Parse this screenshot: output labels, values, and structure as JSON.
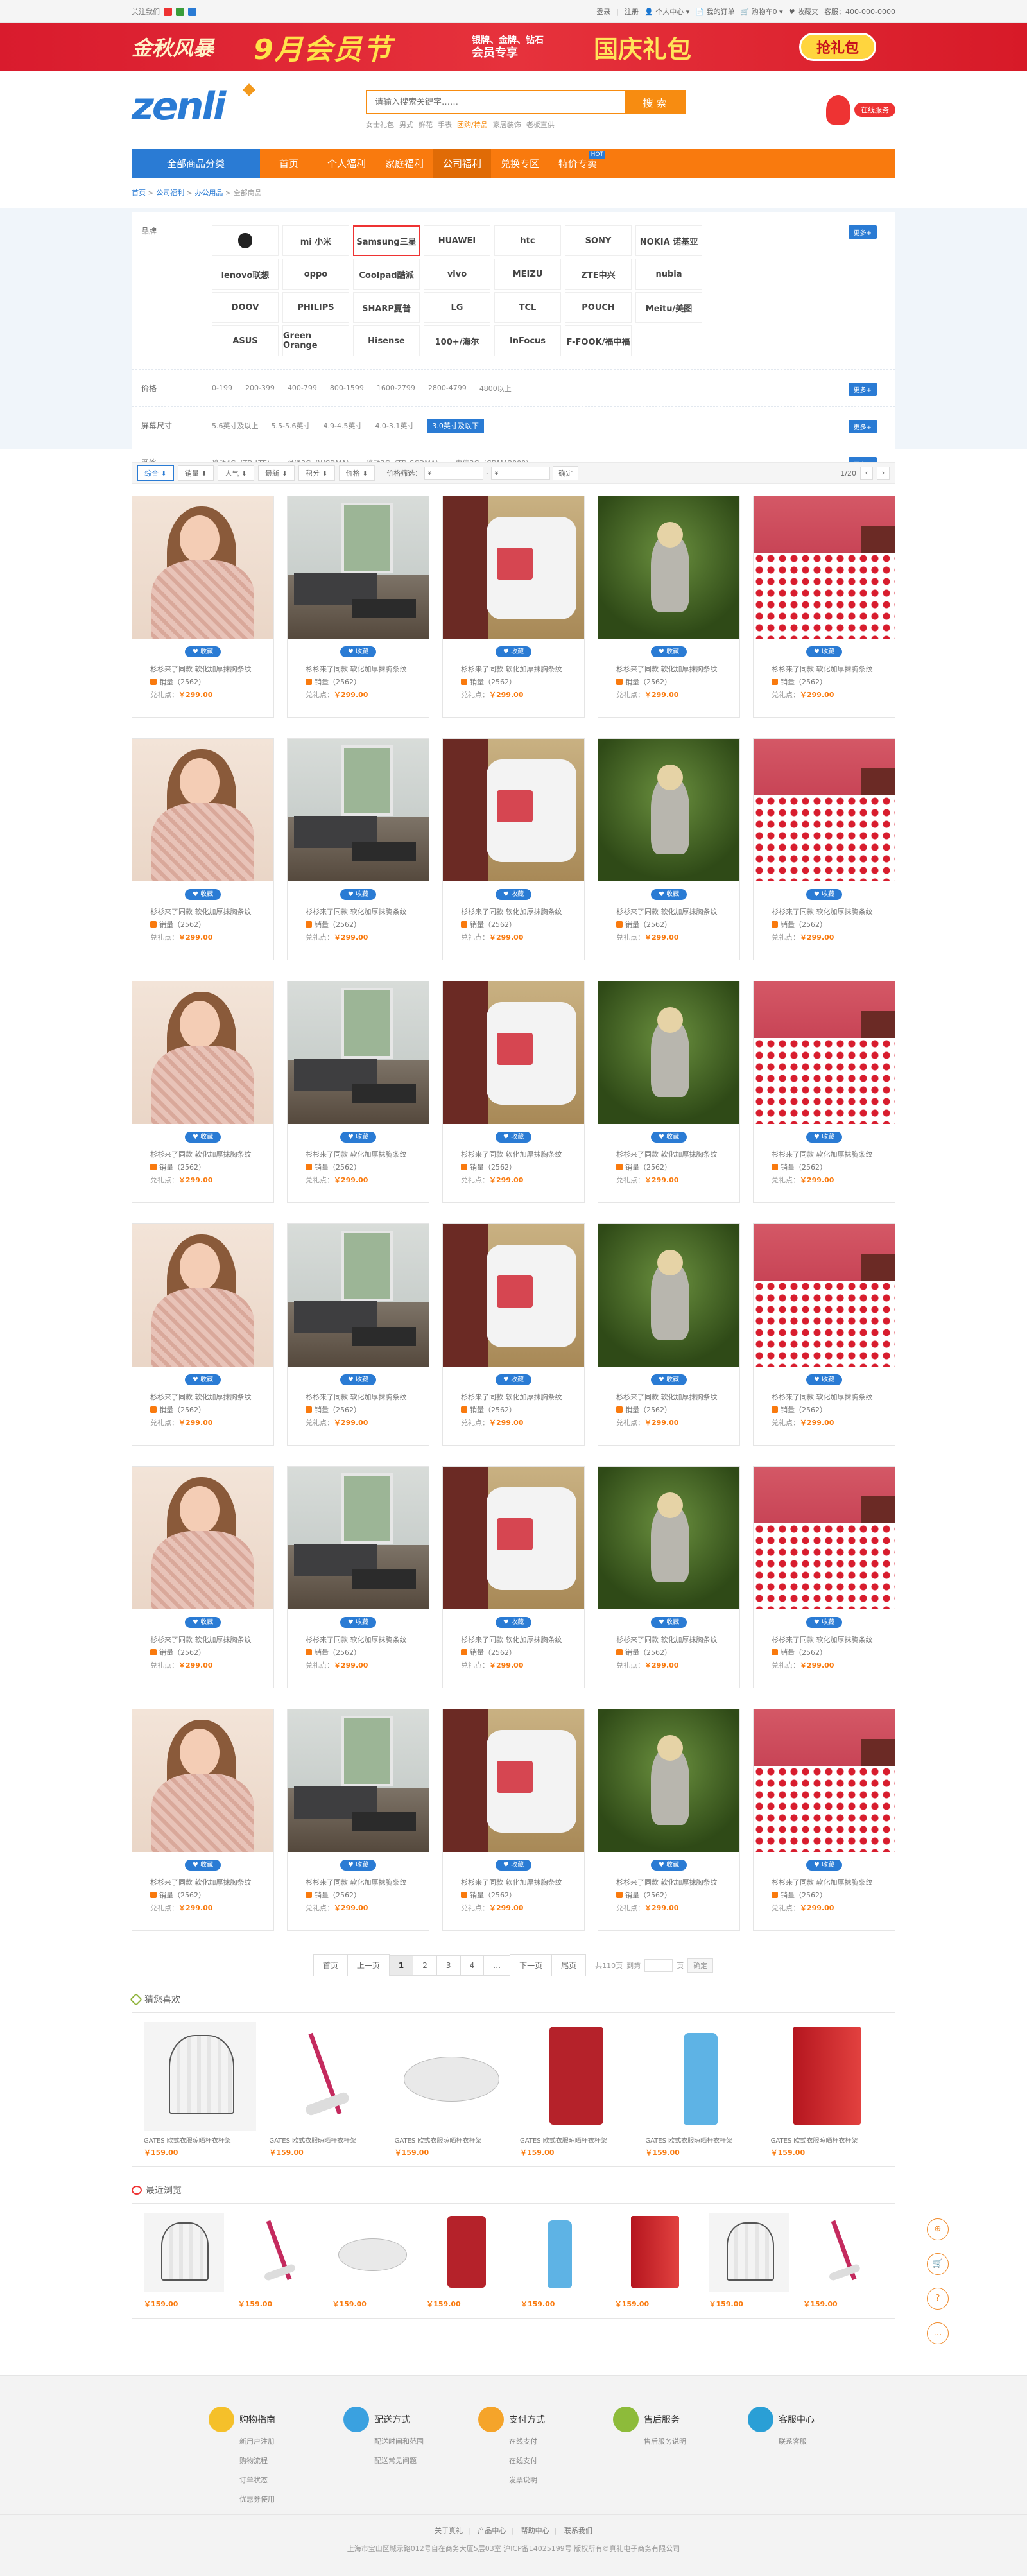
{
  "topbar": {
    "follow": "关注我们",
    "login": "登录",
    "register": "注册",
    "user_center": "个人中心",
    "orders": "我的订单",
    "cart": "购物车",
    "cart_count": "0",
    "favorites": "收藏夹",
    "hotline": "客服：400-000-0000"
  },
  "banner": {
    "a": "金秋风暴",
    "b": "9月会员节",
    "c1": "银牌、金牌、钻石",
    "c2": "会员专享",
    "d": "国庆礼包",
    "btn": "抢礼包"
  },
  "header": {
    "logo": "zenli",
    "search_placeholder": "请输入搜索关键字……",
    "search_btn": "搜 索",
    "hot_words": [
      "女士礼包",
      "男式",
      "鲜花",
      "手表",
      "团购/特品",
      "家居装饰",
      "老板直供"
    ],
    "service": "在线服务"
  },
  "nav": {
    "all": "全部商品分类",
    "items": [
      "首页",
      "个人福利",
      "家庭福利",
      "公司福利",
      "兑换专区",
      "特价专卖"
    ],
    "hot_badge": "HOT"
  },
  "breadcrumb": [
    "首页",
    "公司福利",
    "办公用品",
    "全部商品"
  ],
  "filter": {
    "brand_label": "品牌",
    "brands": [
      "",
      "mi 小米",
      "Samsung三星",
      "HUAWEI",
      "htc",
      "SONY",
      "NOKIA 诺基亚",
      "lenovo联想",
      "oppo",
      "Coolpad酷派",
      "vivo",
      "MEIZU",
      "ZTE中兴",
      "nubia",
      "DOOV",
      "PHILIPS",
      "SHARP夏普",
      "LG",
      "TCL",
      "POUCH",
      "Meitu/美图",
      "ASUS",
      "Green Orange",
      "Hisense",
      "100+/海尔",
      "InFocus",
      "F-FOOK/福中福"
    ],
    "price_label": "价格",
    "prices": [
      "0-199",
      "200-399",
      "400-799",
      "800-1599",
      "1600-2799",
      "2800-4799",
      "4800以上"
    ],
    "screen_label": "屏幕尺寸",
    "screens": [
      "5.6英寸及以上",
      "5.5-5.6英寸",
      "4.9-4.5英寸",
      "4.0-3.1英寸",
      "3.0英寸及以下"
    ],
    "net_label": "网络",
    "nets": [
      "移动4G（TD-LTE）",
      "联通3G（WCDMA）",
      "移动3G（TD-SCDMA）",
      "电信3G（CDMA2000）"
    ],
    "more": "更多"
  },
  "sortbar": {
    "sorts": [
      "综合",
      "销量",
      "人气",
      "最新",
      "积分",
      "价格"
    ],
    "price_filter_label": "价格筛选：",
    "price_from": "¥",
    "price_to": "¥",
    "confirm": "确定",
    "page": "1/20"
  },
  "product_common": {
    "fav": "♥ 收藏",
    "title": "杉杉来了同款 软化加厚抹胸条纹",
    "sales": "销量（2562）",
    "price_label": "兑礼点：",
    "price": "￥299.00"
  },
  "products": [
    {
      "img": "scarf"
    },
    {
      "img": "room"
    },
    {
      "img": "cooker"
    },
    {
      "img": "boy"
    },
    {
      "img": "bed"
    },
    {
      "img": "scarf"
    },
    {
      "img": "room"
    },
    {
      "img": "cooker"
    },
    {
      "img": "boy"
    },
    {
      "img": "bed"
    },
    {
      "img": "scarf"
    },
    {
      "img": "room"
    },
    {
      "img": "cooker"
    },
    {
      "img": "boy"
    },
    {
      "img": "bed"
    },
    {
      "img": "scarf"
    },
    {
      "img": "room"
    },
    {
      "img": "cooker"
    },
    {
      "img": "boy"
    },
    {
      "img": "bed"
    },
    {
      "img": "scarf"
    },
    {
      "img": "room"
    },
    {
      "img": "cooker"
    },
    {
      "img": "boy"
    },
    {
      "img": "bed"
    },
    {
      "img": "scarf"
    },
    {
      "img": "room"
    },
    {
      "img": "cooker"
    },
    {
      "img": "boy"
    },
    {
      "img": "bed"
    }
  ],
  "pager": {
    "first": "首页",
    "prev": "上一页",
    "pages": [
      "1",
      "2",
      "3",
      "4",
      "…"
    ],
    "next": "下一页",
    "last": "尾页",
    "total": "共110页",
    "goto": "到第",
    "unit": "页",
    "go": "确定"
  },
  "likes": {
    "title": "猜您喜欢",
    "title_text": "GATES 欧式衣服晾晒杆衣杆架",
    "price": "￥159.00",
    "items": [
      "shirts",
      "vac",
      "bot",
      "zip",
      "bot2",
      "red"
    ]
  },
  "recent": {
    "title": "最近浏览",
    "price": "￥159.00",
    "items": [
      "shirts",
      "vac",
      "bot",
      "zip",
      "bot2",
      "red",
      "shirts",
      "vac"
    ]
  },
  "sidefloat": [
    "⊕",
    "🛒",
    "?",
    "…"
  ],
  "footer": {
    "cols": [
      {
        "title": "购物指南",
        "color": "#f5c02a",
        "links": [
          "新用户注册",
          "购物流程",
          "订单状态",
          "优惠券使用"
        ]
      },
      {
        "title": "配送方式",
        "color": "#3aa1e0",
        "links": [
          "配送时间和范围",
          "配送常见问题"
        ]
      },
      {
        "title": "支付方式",
        "color": "#f5a42a",
        "links": [
          "在线支付",
          "在线支付",
          "发票说明"
        ]
      },
      {
        "title": "售后服务",
        "color": "#8dbb3a",
        "links": [
          "售后服务说明"
        ]
      },
      {
        "title": "客服中心",
        "color": "#2a9fd6",
        "links": [
          "联系客服"
        ]
      }
    ],
    "links": [
      "关于真礼",
      "产品中心",
      "帮助中心",
      "联系我们"
    ],
    "copyright": "上海市宝山区城示路012号自在商务大厦5层03室 沪ICP备14025199号 版权所有©真礼电子商务有限公司"
  }
}
